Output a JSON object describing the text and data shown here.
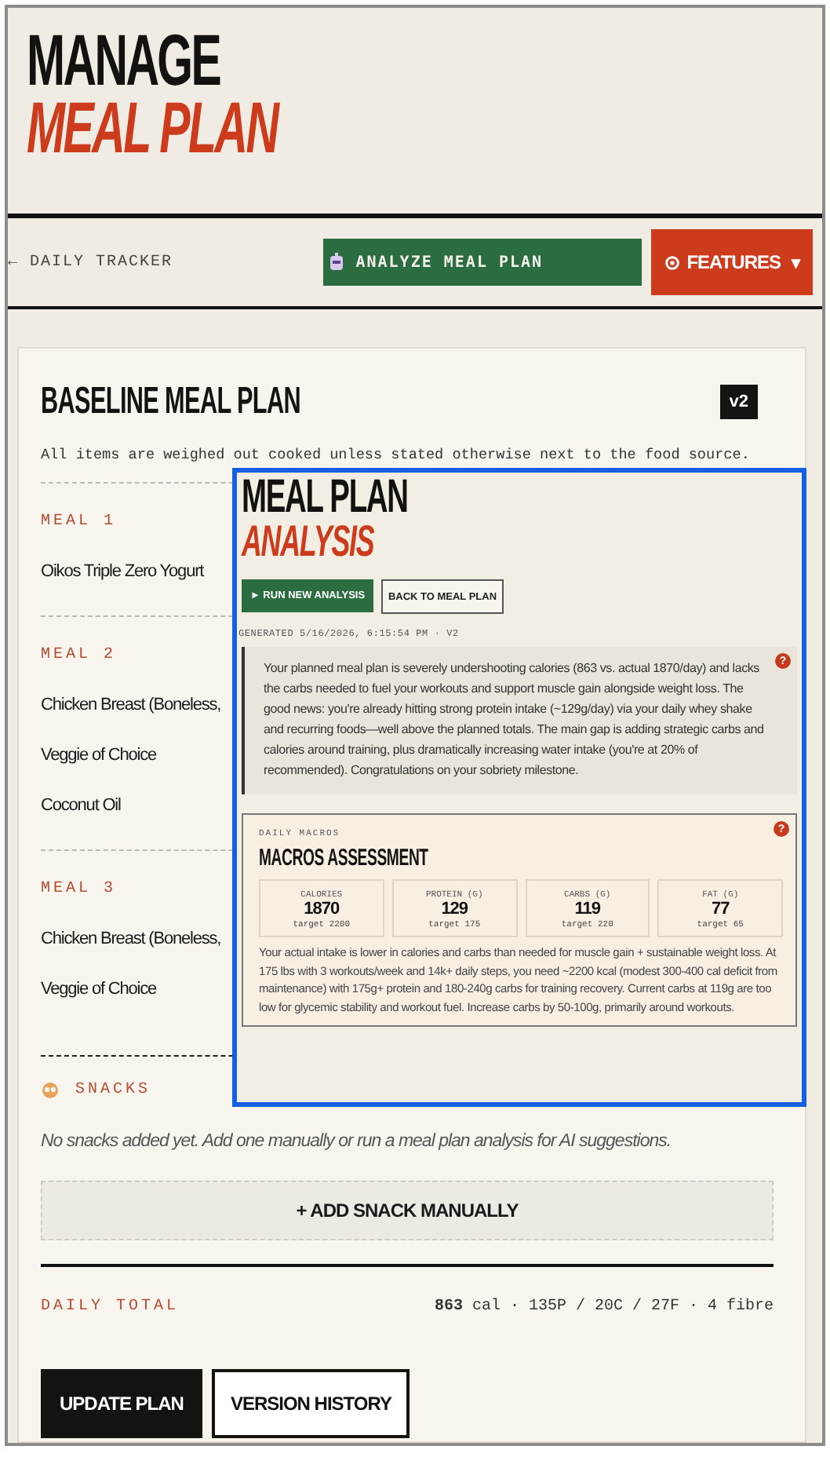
{
  "header": {
    "title_top": "MANAGE",
    "title_bottom": "MEAL PLAN"
  },
  "nav": {
    "back_link": "← DAILY TRACKER",
    "analyze_button": "ANALYZE MEAL PLAN",
    "features_button": "FEATURES",
    "features_caret": "▾"
  },
  "plan": {
    "title": "BASELINE MEAL PLAN",
    "version": "v2",
    "note": "All items are weighed out cooked unless stated otherwise next to the food source.",
    "meals": [
      {
        "label": "MEAL 1",
        "items": [
          "Oikos Triple Zero Yogurt"
        ]
      },
      {
        "label": "MEAL 2",
        "items": [
          "Chicken Breast (Boneless,",
          "Veggie of Choice",
          "Coconut Oil"
        ]
      },
      {
        "label": "MEAL 3",
        "items": [
          "Chicken Breast (Boneless,",
          "Veggie of Choice"
        ]
      }
    ],
    "snacks": {
      "label": "SNACKS",
      "empty_text": "No snacks added yet. Add one manually or run a meal plan analysis for AI suggestions.",
      "add_button": "+ ADD SNACK MANUALLY"
    },
    "daily_total": {
      "label": "DAILY TOTAL",
      "calories": "863",
      "rest": "cal · 135P / 20C / 27F · 4 fibre"
    },
    "buttons": [
      {
        "label": "UPDATE PLAN",
        "kind": "primary"
      },
      {
        "label": "VERSION HISTORY",
        "kind": "secondary"
      }
    ]
  },
  "analysis": {
    "title_top": "MEAL PLAN",
    "title_bottom": "ANALYSIS",
    "run_button": "► RUN NEW ANALYSIS",
    "back_button": "BACK TO MEAL PLAN",
    "generated": "GENERATED 5/16/2026, 6:15:54 PM · V2",
    "summary": {
      "badge": "?",
      "text": "Your planned meal plan is severely undershooting calories (863 vs. actual 1870/day) and lacks the carbs needed to fuel your workouts and support muscle gain alongside weight loss. The good news: you're already hitting strong protein intake (~129g/day) via your daily whey shake and recurring foods—well above the planned totals. The main gap is adding strategic carbs and calories around training, plus dramatically increasing water intake (you're at 20% of recommended). Congratulations on your sobriety milestone."
    },
    "macros": {
      "eyebrow": "DAILY MACROS",
      "title": "MACROS ASSESSMENT",
      "badge": "?",
      "stats": [
        {
          "label": "CALORIES",
          "value": "1870",
          "target": "target 2200"
        },
        {
          "label": "PROTEIN (G)",
          "value": "129",
          "target": "target 175"
        },
        {
          "label": "CARBS (G)",
          "value": "119",
          "target": "target 220"
        },
        {
          "label": "FAT (G)",
          "value": "77",
          "target": "target 65"
        }
      ],
      "text": "Your actual intake is lower in calories and carbs than needed for muscle gain + sustainable weight loss. At 175 lbs with 3 workouts/week and 14k+ daily steps, you need ~2200 kcal (modest 300-400 cal deficit from maintenance) with 175g+ protein and 180-240g carbs for training recovery. Current carbs at 119g are too low for glycemic stability and workout fuel. Increase carbs by 50-100g, primarily around workouts."
    }
  }
}
